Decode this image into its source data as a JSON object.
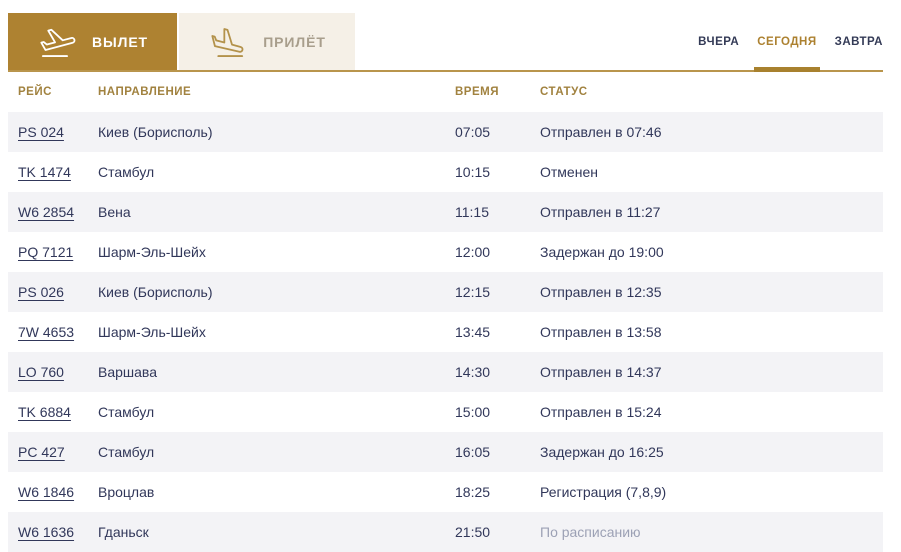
{
  "board": {
    "tabs": [
      {
        "label": "ВЫЛЕТ",
        "icon": "plane-takeoff-icon",
        "active": true
      },
      {
        "label": "ПРИЛЁТ",
        "icon": "plane-landing-icon",
        "active": false
      }
    ],
    "date_tabs": [
      {
        "label": "ВЧЕРА",
        "active": false
      },
      {
        "label": "СЕГОДНЯ",
        "active": true
      },
      {
        "label": "ЗАВТРА",
        "active": false
      }
    ]
  },
  "table": {
    "columns": [
      "РЕЙС",
      "НАПРАВЛЕНИЕ",
      "ВРЕМЯ",
      "СТАТУС"
    ],
    "rows": [
      {
        "flight": "PS 024",
        "destination": "Киев (Борисполь)",
        "time": "07:05",
        "status": "Отправлен в 07:46",
        "status_muted": false
      },
      {
        "flight": "TK 1474",
        "destination": "Стамбул",
        "time": "10:15",
        "status": "Отменен",
        "status_muted": false
      },
      {
        "flight": "W6 2854",
        "destination": "Вена",
        "time": "11:15",
        "status": "Отправлен в 11:27",
        "status_muted": false
      },
      {
        "flight": "PQ 7121",
        "destination": "Шарм-Эль-Шейх",
        "time": "12:00",
        "status": "Задержан до 19:00",
        "status_muted": false
      },
      {
        "flight": "PS 026",
        "destination": "Киев (Борисполь)",
        "time": "12:15",
        "status": "Отправлен в 12:35",
        "status_muted": false
      },
      {
        "flight": "7W 4653",
        "destination": "Шарм-Эль-Шейх",
        "time": "13:45",
        "status": "Отправлен в 13:58",
        "status_muted": false
      },
      {
        "flight": "LO 760",
        "destination": "Варшава",
        "time": "14:30",
        "status": "Отправлен в 14:37",
        "status_muted": false
      },
      {
        "flight": "TK 6884",
        "destination": "Стамбул",
        "time": "15:00",
        "status": "Отправлен в 15:24",
        "status_muted": false
      },
      {
        "flight": "PC 427",
        "destination": "Стамбул",
        "time": "16:05",
        "status": "Задержан до 16:25",
        "status_muted": false
      },
      {
        "flight": "W6 1846",
        "destination": "Вроцлав",
        "time": "18:25",
        "status": "Регистрация (7,8,9)",
        "status_muted": false
      },
      {
        "flight": "W6 1636",
        "destination": "Гданьск",
        "time": "21:50",
        "status": "По расписанию",
        "status_muted": true
      }
    ]
  },
  "colors": {
    "accent_gold": "#AE8231",
    "rule_gold": "#B9954C",
    "active_underline": "#A8812E",
    "tab_inactive_bg": "#F5F0E7",
    "tab_inactive_text": "#A89E8C",
    "tab_inactive_icon": "#B3924B",
    "header_text": "#A1823F",
    "body_text": "#31375A",
    "muted_status": "#9CA1B5",
    "row_alt_bg": "#F3F3F6"
  }
}
